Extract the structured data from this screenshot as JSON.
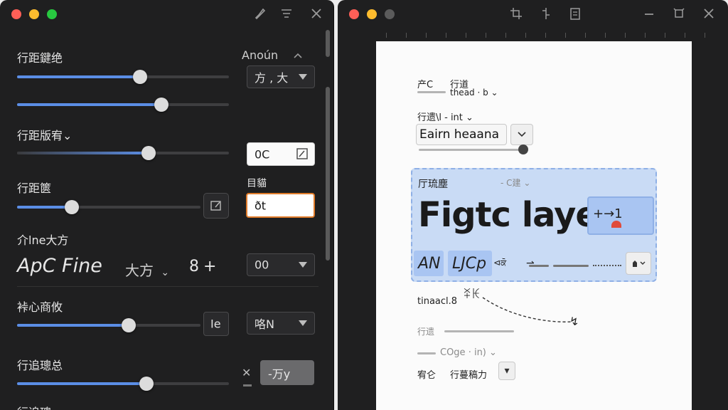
{
  "left": {
    "section1": {
      "label": "行距鍵绝",
      "option_label": "Anoún",
      "select_value": "方 , 大"
    },
    "section2": {
      "label": "行距版宥⌄",
      "input_value": "0C"
    },
    "section3": {
      "label": "行距篋",
      "field_caption": "目貓",
      "field_value": "ðt"
    },
    "section4": {
      "label": "介lne大方",
      "font_name": "ApC Fine",
      "style_name": "大方",
      "size_value": "8",
      "plus_label": "+",
      "select_value": "00"
    },
    "section5": {
      "label": "裃心商攸",
      "small_value": "Ie",
      "select_value": "咯N"
    },
    "section6": {
      "label": "行追璁总",
      "close_label": "✕",
      "field_value": "-万y"
    },
    "section7": {
      "label": "行追璁"
    },
    "colors": {
      "accent": "#5b8ee6",
      "focus": "#e07b2a"
    },
    "slider_levels": [
      0.58,
      0.68,
      0.62,
      0.3,
      0.61,
      0.61
    ]
  },
  "right": {
    "page": {
      "p1_a": "产C",
      "p1_b": "行道",
      "p1_c": "thead · b ⌄",
      "p2": "行遗\\l  - int ⌄",
      "dropdown_value": "Eairn heaana",
      "sel_caption": "厅琉塵",
      "sel_caption_b": "- C建 ⌄",
      "big_text": "Figtc laye",
      "badge_text": "+→1",
      "btn_a": "AN",
      "btn_b": "LJCp",
      "btn_b_suffix": "⊲ਕੋ",
      "arrow_label": "⇀",
      "after_a": "ꋏꀘ",
      "after_b": "tinaacl.8",
      "after_arrow": "↯",
      "row_a": "行遗",
      "row_b": "COge · in) ⌄",
      "row_c1": "宥仑",
      "row_c2": "行蔓稿力",
      "row_c3": "▾"
    },
    "colors": {
      "selection": "#c9dbf5",
      "selection_border": "#8fb0e6"
    }
  }
}
